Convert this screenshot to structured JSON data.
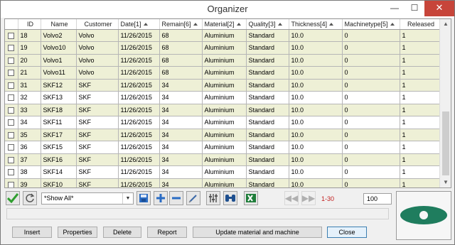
{
  "window": {
    "title": "Organizer"
  },
  "titlebar": {
    "min_glyph": "—",
    "max_glyph": "☐",
    "close_glyph": "✕"
  },
  "grid": {
    "columns": [
      "",
      "ID",
      "Name",
      "Customer",
      "Date[1]",
      "Remain[6]",
      "Material[2]",
      "Quality[3]",
      "Thickness[4]",
      "Machinetype[5]",
      "Released"
    ],
    "rows": [
      [
        "18",
        "Volvo2",
        "Volvo",
        "11/26/2015",
        "68",
        "Aluminium",
        "Standard",
        "10.0",
        "0",
        "1"
      ],
      [
        "19",
        "Volvo10",
        "Volvo",
        "11/26/2015",
        "68",
        "Aluminium",
        "Standard",
        "10.0",
        "0",
        "1"
      ],
      [
        "20",
        "Volvo1",
        "Volvo",
        "11/26/2015",
        "68",
        "Aluminium",
        "Standard",
        "10.0",
        "0",
        "1"
      ],
      [
        "21",
        "Volvo11",
        "Volvo",
        "11/26/2015",
        "68",
        "Aluminium",
        "Standard",
        "10.0",
        "0",
        "1"
      ],
      [
        "31",
        "SKF12",
        "SKF",
        "11/26/2015",
        "34",
        "Aluminium",
        "Standard",
        "10.0",
        "0",
        "1"
      ],
      [
        "32",
        "SKF13",
        "SKF",
        "11/26/2015",
        "34",
        "Aluminium",
        "Standard",
        "10.0",
        "0",
        "1"
      ],
      [
        "33",
        "SKF18",
        "SKF",
        "11/26/2015",
        "34",
        "Aluminium",
        "Standard",
        "10.0",
        "0",
        "1"
      ],
      [
        "34",
        "SKF11",
        "SKF",
        "11/26/2015",
        "34",
        "Aluminium",
        "Standard",
        "10.0",
        "0",
        "1"
      ],
      [
        "35",
        "SKF17",
        "SKF",
        "11/26/2015",
        "34",
        "Aluminium",
        "Standard",
        "10.0",
        "0",
        "1"
      ],
      [
        "36",
        "SKF15",
        "SKF",
        "11/26/2015",
        "34",
        "Aluminium",
        "Standard",
        "10.0",
        "0",
        "1"
      ],
      [
        "37",
        "SKF16",
        "SKF",
        "11/26/2015",
        "34",
        "Aluminium",
        "Standard",
        "10.0",
        "0",
        "1"
      ],
      [
        "38",
        "SKF14",
        "SKF",
        "11/26/2015",
        "34",
        "Aluminium",
        "Standard",
        "10.0",
        "0",
        "1"
      ],
      [
        "39",
        "SKF10",
        "SKF",
        "11/26/2015",
        "34",
        "Aluminium",
        "Standard",
        "10.0",
        "0",
        "1"
      ]
    ]
  },
  "toolbar": {
    "filter_value": "*Show All*",
    "range_text": "1-30",
    "page_size": "100",
    "icons": [
      "check-icon",
      "refresh-icon",
      "save-icon",
      "add-icon",
      "remove-icon",
      "edit-icon",
      "settings-icon",
      "binoculars-icon",
      "excel-export-icon",
      "previous-page-icon",
      "next-page-icon"
    ]
  },
  "buttons": {
    "insert": "Insert",
    "properties": "Properties",
    "delete": "Delete",
    "report": "Report",
    "update": "Update material and machine",
    "close": "Close"
  },
  "colors": {
    "row_highlight": "#eef0d6",
    "accent_green": "#1f7d5e",
    "accent_blue": "#2a6cc4",
    "close_red": "#c7453a"
  }
}
